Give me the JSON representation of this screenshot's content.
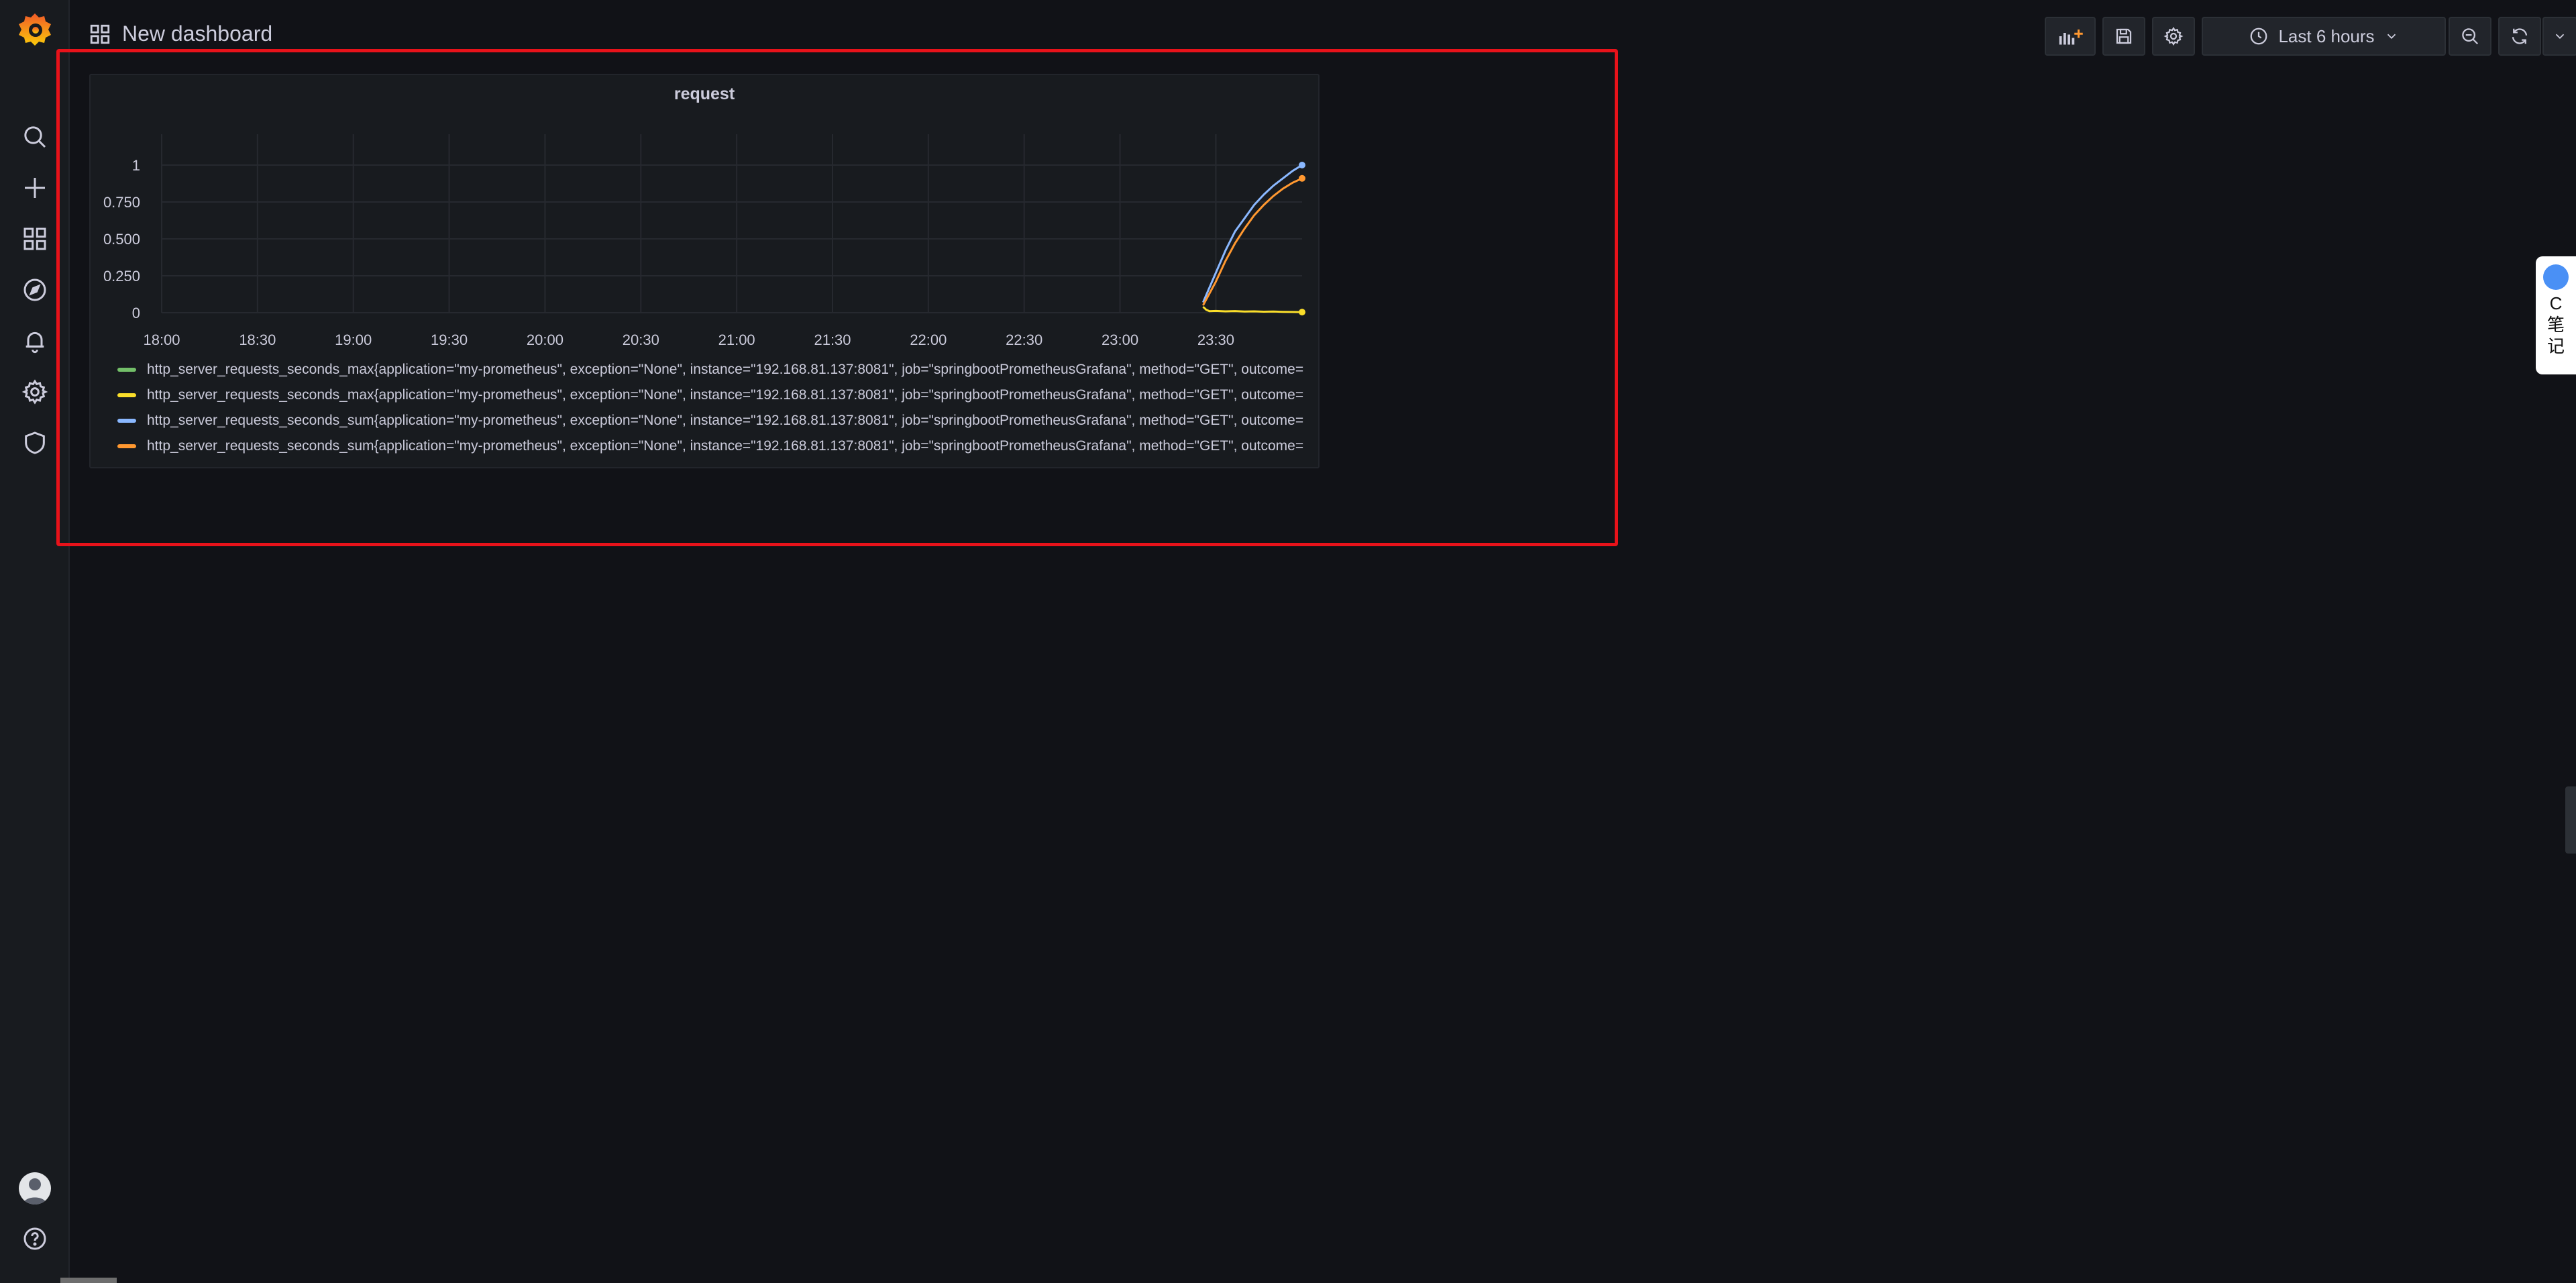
{
  "dashboard": {
    "title": "New dashboard"
  },
  "toolbar": {
    "time_range": "Last 6 hours"
  },
  "panel": {
    "title": "request"
  },
  "side_widget": {
    "line1": "C",
    "line2": "笔",
    "line3": "记"
  },
  "icons": {
    "sidebar": [
      "grafana-logo-icon",
      "search-icon",
      "plus-icon",
      "dashboards-icon",
      "explore-icon",
      "bell-icon",
      "gear-icon",
      "shield-icon",
      "avatar",
      "help-icon"
    ],
    "toolbar": [
      "add-panel-icon",
      "save-icon",
      "gear-icon",
      "clock-icon",
      "chevron-down-icon",
      "zoom-out-icon",
      "refresh-icon",
      "chevron-down-icon",
      "tv-icon"
    ]
  },
  "chart_data": {
    "type": "line",
    "title": "request",
    "xlabel": "",
    "ylabel": "",
    "x_ticks": [
      "18:00",
      "18:30",
      "19:00",
      "19:30",
      "20:00",
      "20:30",
      "21:00",
      "21:30",
      "22:00",
      "22:30",
      "23:00",
      "23:30"
    ],
    "y_ticks": [
      "0",
      "0.250",
      "0.500",
      "0.750",
      "1"
    ],
    "ylim": [
      0,
      1.0
    ],
    "x_range": [
      "18:00",
      "23:57"
    ],
    "grid": true,
    "legend_placement": "bottom",
    "series": [
      {
        "name": "http_server_requests_seconds_max{application=\"my-prometheus\", exception=\"None\", instance=\"192.168.81.137:8081\", job=\"springbootPrometheusGrafana\", method=\"GET\", outcome=",
        "color": "#73bf69",
        "x": [],
        "y": []
      },
      {
        "name": "http_server_requests_seconds_max{application=\"my-prometheus\", exception=\"None\", instance=\"192.168.81.137:8081\", job=\"springbootPrometheusGrafana\", method=\"GET\", outcome=",
        "color": "#fade2a",
        "x": [
          "23:26",
          "23:27",
          "23:28",
          "23:30",
          "23:33",
          "23:36",
          "23:39",
          "23:42",
          "23:45",
          "23:48",
          "23:51",
          "23:54",
          "23:57"
        ],
        "y": [
          0.04,
          0.02,
          0.01,
          0.012,
          0.009,
          0.011,
          0.008,
          0.009,
          0.007,
          0.008,
          0.006,
          0.005,
          0.004
        ]
      },
      {
        "name": "http_server_requests_seconds_sum{application=\"my-prometheus\", exception=\"None\", instance=\"192.168.81.137:8081\", job=\"springbootPrometheusGrafana\", method=\"GET\", outcome=",
        "color": "#8ab8ff",
        "x": [
          "23:26",
          "23:30",
          "23:33",
          "23:36",
          "23:39",
          "23:42",
          "23:45",
          "23:48",
          "23:51",
          "23:54",
          "23:57"
        ],
        "y": [
          0.07,
          0.27,
          0.42,
          0.55,
          0.64,
          0.73,
          0.8,
          0.86,
          0.91,
          0.96,
          1.0
        ]
      },
      {
        "name": "http_server_requests_seconds_sum{application=\"my-prometheus\", exception=\"None\", instance=\"192.168.81.137:8081\", job=\"springbootPrometheusGrafana\", method=\"GET\", outcome=",
        "color": "#ff9830",
        "x": [
          "23:26",
          "23:30",
          "23:33",
          "23:36",
          "23:39",
          "23:42",
          "23:45",
          "23:48",
          "23:51",
          "23:54",
          "23:57"
        ],
        "y": [
          0.05,
          0.21,
          0.35,
          0.47,
          0.57,
          0.66,
          0.73,
          0.79,
          0.84,
          0.88,
          0.91
        ]
      }
    ]
  }
}
